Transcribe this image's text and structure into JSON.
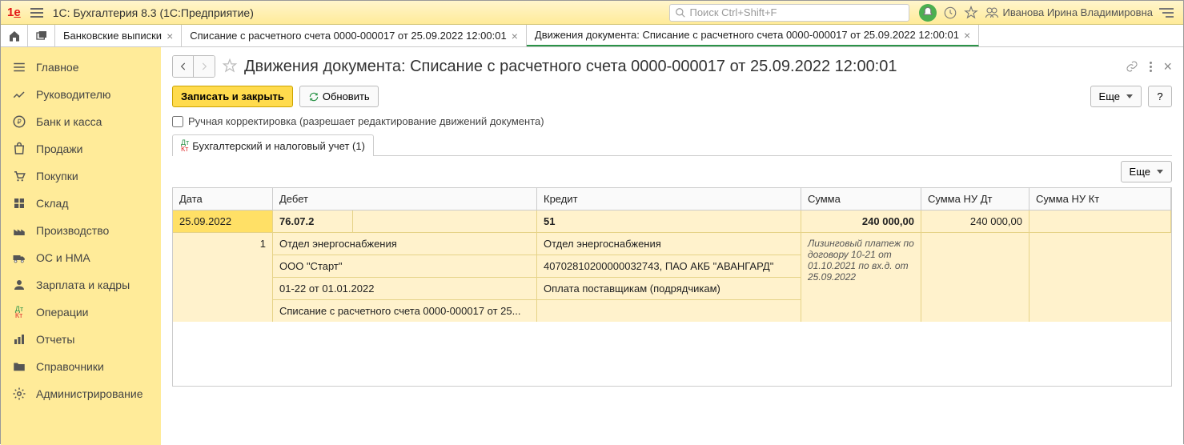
{
  "header": {
    "app_title": "1С: Бухгалтерия 8.3  (1С:Предприятие)",
    "search_placeholder": "Поиск Ctrl+Shift+F",
    "user_name": "Иванова Ирина Владимировна"
  },
  "tabs": [
    {
      "label": "Банковские выписки"
    },
    {
      "label": "Списание с расчетного счета 0000-000017 от 25.09.2022 12:00:01"
    },
    {
      "label": "Движения документа: Списание с расчетного счета 0000-000017 от 25.09.2022 12:00:01"
    }
  ],
  "sidebar": {
    "items": [
      {
        "label": "Главное"
      },
      {
        "label": "Руководителю"
      },
      {
        "label": "Банк и касса"
      },
      {
        "label": "Продажи"
      },
      {
        "label": "Покупки"
      },
      {
        "label": "Склад"
      },
      {
        "label": "Производство"
      },
      {
        "label": "ОС и НМА"
      },
      {
        "label": "Зарплата и кадры"
      },
      {
        "label": "Операции"
      },
      {
        "label": "Отчеты"
      },
      {
        "label": "Справочники"
      },
      {
        "label": "Администрирование"
      }
    ]
  },
  "page": {
    "title": "Движения документа: Списание с расчетного счета 0000-000017 от 25.09.2022 12:00:01",
    "btn_save_close": "Записать и закрыть",
    "btn_refresh": "Обновить",
    "btn_more": "Еще",
    "btn_help": "?",
    "chk_manual": "Ручная корректировка (разрешает редактирование движений документа)",
    "tab_accounting": "Бухгалтерский и налоговый учет (1)"
  },
  "grid": {
    "headers": {
      "date": "Дата",
      "debit": "Дебет",
      "credit": "Кредит",
      "sum": "Сумма",
      "sumdt": "Сумма НУ Дт",
      "sumkt": "Сумма НУ Кт"
    },
    "row": {
      "date": "25.09.2022",
      "debit_account": "76.07.2",
      "credit_account": "51",
      "sum": "240 000,00",
      "sum_dt": "240 000,00",
      "num": "1",
      "debit_details": [
        "Отдел энергоснабжения",
        "ООО \"Старт\"",
        "01-22 от 01.01.2022",
        "Списание с расчетного счета 0000-000017 от 25..."
      ],
      "credit_details": [
        "Отдел энергоснабжения",
        "40702810200000032743, ПАО АКБ \"АВАНГАРД\"",
        "Оплата поставщикам (подрядчикам)"
      ],
      "description": "Лизинговый платеж по договору 10-21 от 01.10.2021 по вх.д. от 25.09.2022"
    }
  }
}
